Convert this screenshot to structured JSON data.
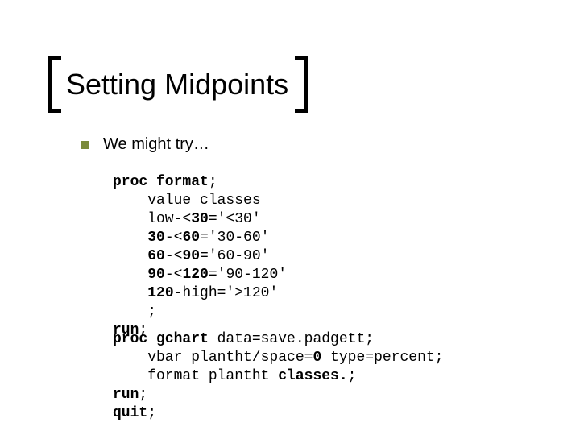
{
  "title": "Setting Midpoints",
  "bullet": "We might try…",
  "code1": {
    "l1a": "proc format",
    "l1b": ";",
    "l2": "    value classes",
    "l3a": "    low-<",
    "l3b": "30",
    "l3c": "='<30'",
    "l4a": "    ",
    "l4b": "30",
    "l4c": "-<",
    "l4d": "60",
    "l4e": "='30-60'",
    "l5a": "    ",
    "l5b": "60",
    "l5c": "-<",
    "l5d": "90",
    "l5e": "='60-90'",
    "l6a": "    ",
    "l6b": "90",
    "l6c": "-<",
    "l6d": "120",
    "l6e": "='90-120'",
    "l7a": "    ",
    "l7b": "120",
    "l7c": "-high='>120'",
    "l8": "    ;",
    "l9a": "run",
    "l9b": ";"
  },
  "code2": {
    "l1a": "proc gchart ",
    "l1b": "data=save.padgett;",
    "l2a": "    vbar plantht/space=",
    "l2b": "0 ",
    "l2c": "type=percent;",
    "l3a": "    format plantht ",
    "l3b": "classes.",
    "l3c": ";",
    "l4a": "run",
    "l4b": ";",
    "l5a": "quit",
    "l5b": ";"
  }
}
